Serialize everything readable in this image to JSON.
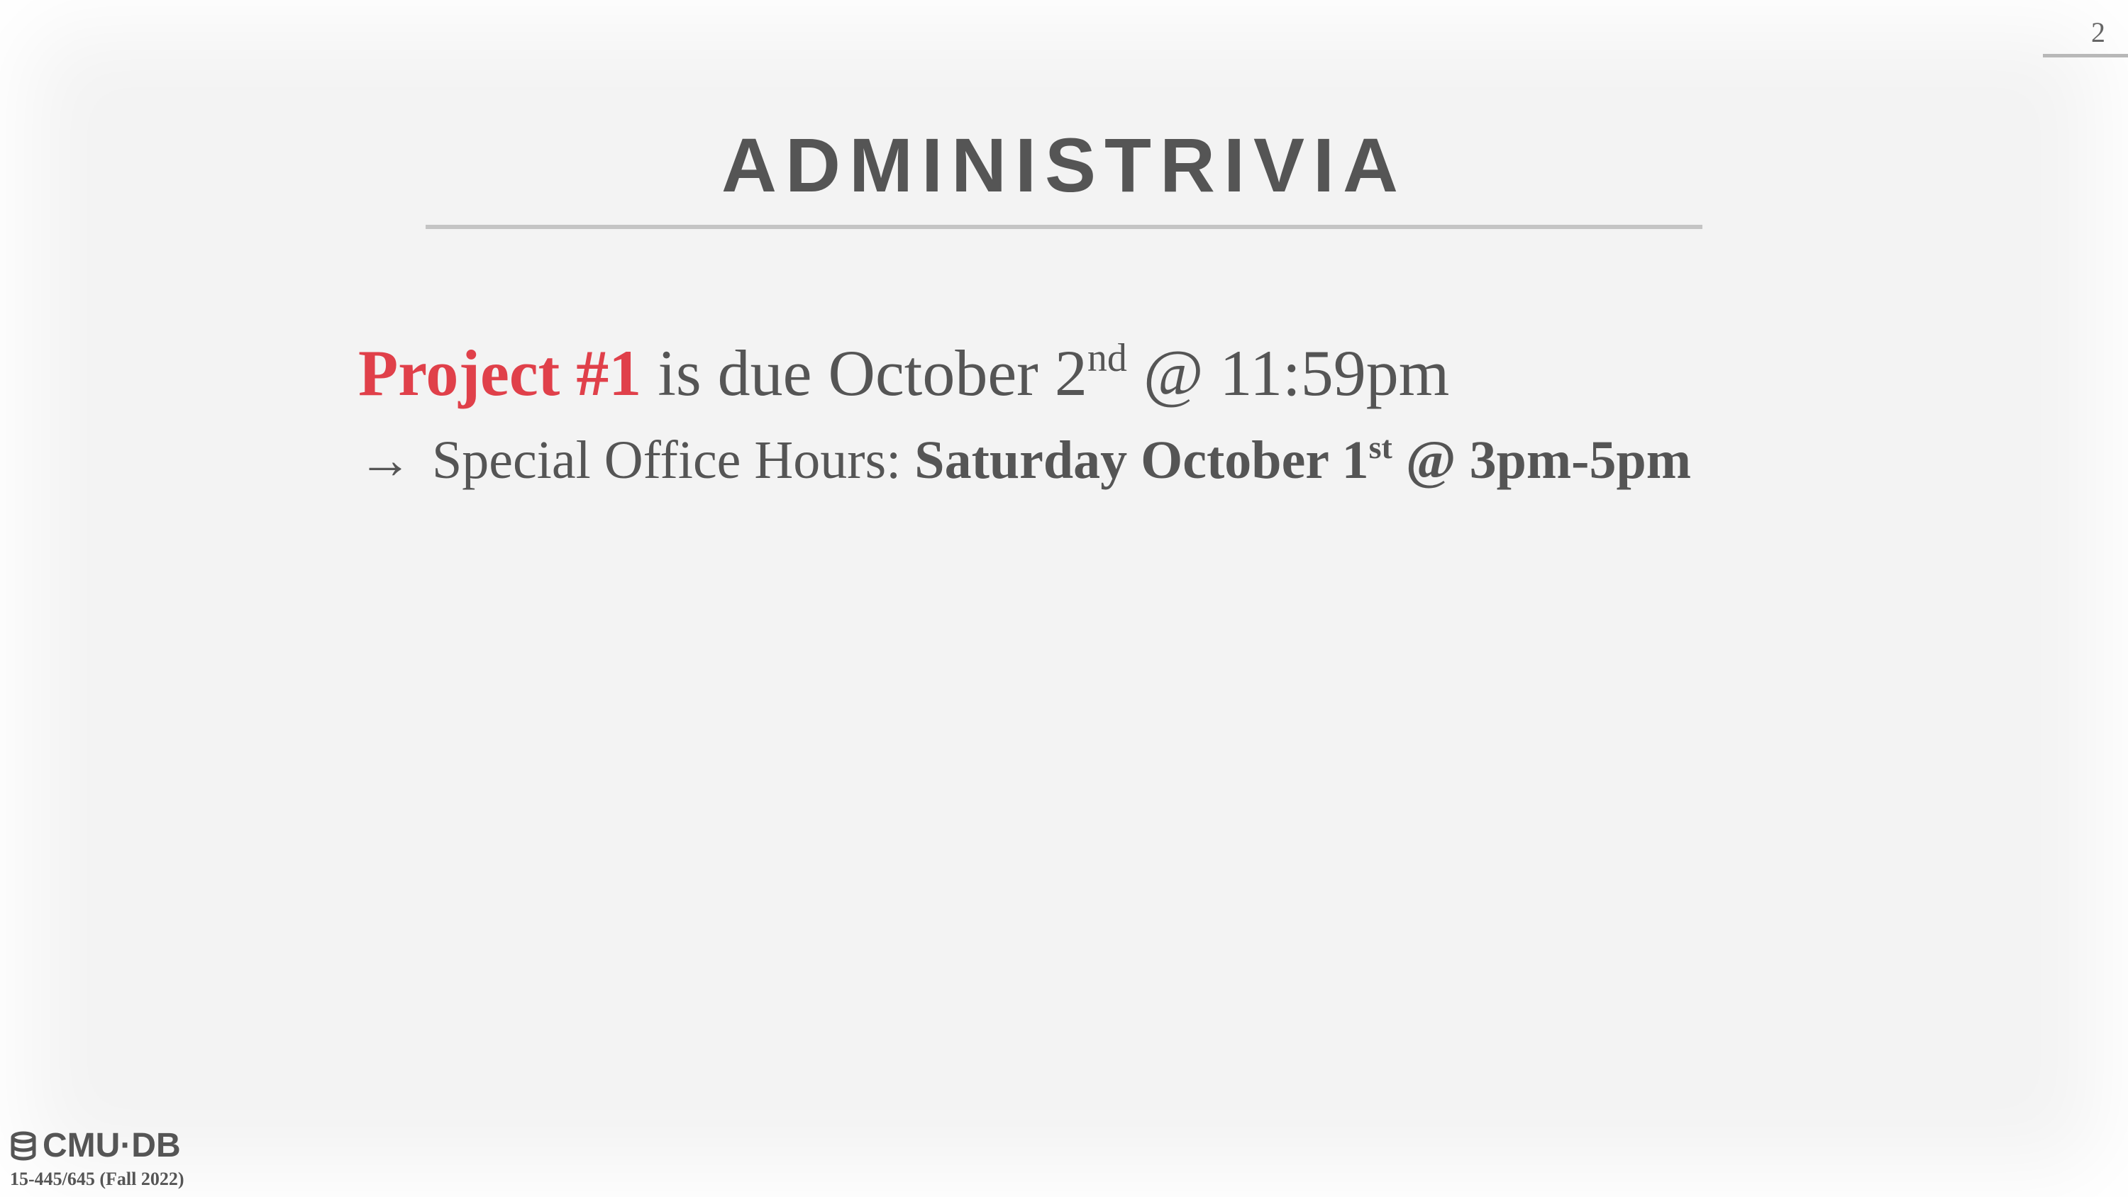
{
  "slide": {
    "page_number": "2",
    "title": "ADMINISTRIVIA"
  },
  "content": {
    "line1": {
      "accent": "Project #1",
      "text_before_sup": " is due October 2",
      "sup": "nd",
      "text_after_sup": " @ 11:59pm"
    },
    "line2": {
      "arrow": "→",
      "label": "Special Office Hours: ",
      "bold_before_sup": "Saturday October 1",
      "sup": "st",
      "bold_after_sup": " @ 3pm-5pm"
    }
  },
  "footer": {
    "logo_text": "CMU·DB",
    "course": "15-445/645 (Fall 2022)"
  },
  "colors": {
    "accent": "#e0404a",
    "text": "#555555",
    "background": "#f3f3f3"
  }
}
